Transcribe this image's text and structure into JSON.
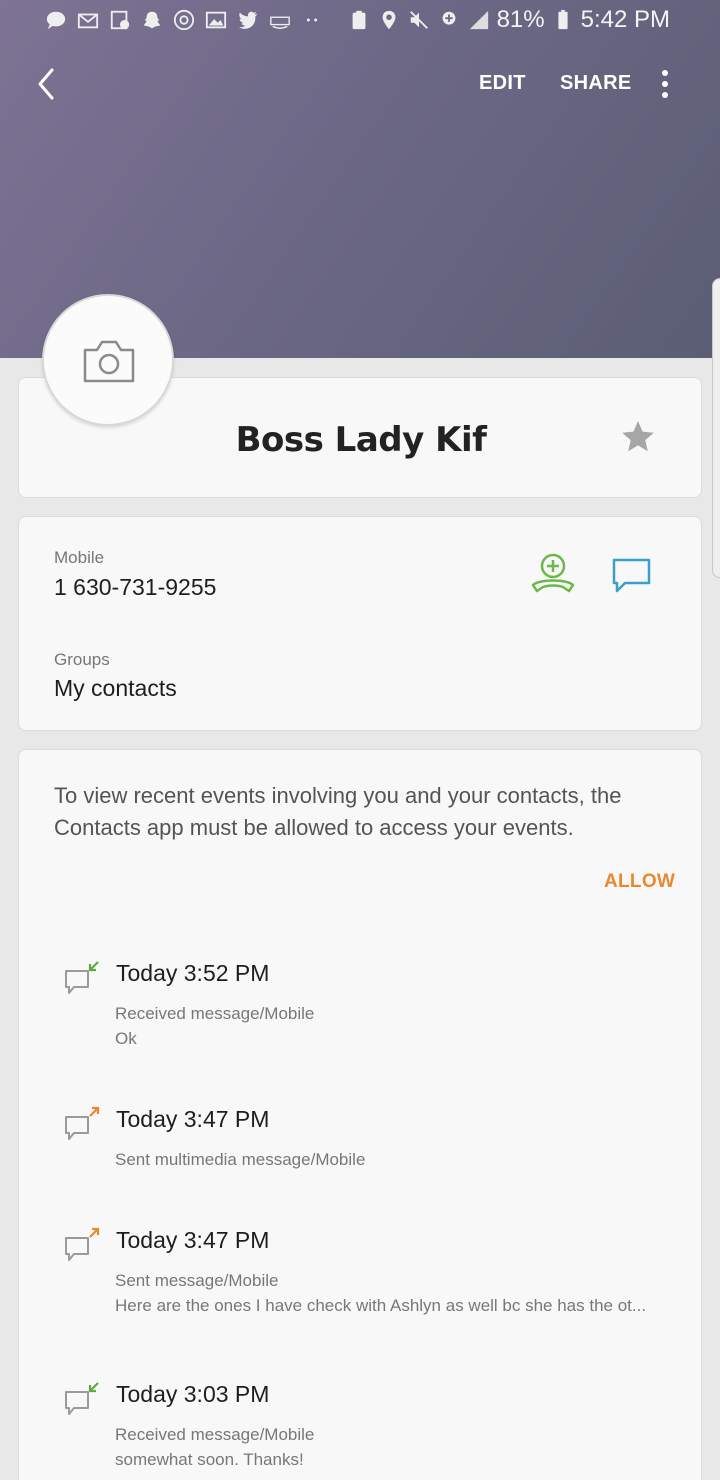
{
  "status_bar": {
    "battery": "81%",
    "time": "5:42 PM",
    "network": "LTE"
  },
  "toolbar": {
    "edit_label": "EDIT",
    "share_label": "SHARE"
  },
  "contact": {
    "name": "Boss Lady Kif",
    "mobile_label": "Mobile",
    "mobile_number": "1 630-731-9255",
    "groups_label": "Groups",
    "groups_value": "My contacts"
  },
  "events": {
    "permission_text": "To view recent events involving you and your contacts, the Contacts app must be allowed to access your events.",
    "allow_label": "ALLOW",
    "items": [
      {
        "title": "Today 3:52 PM",
        "type": "Received message/Mobile",
        "body": "Ok",
        "direction": "received"
      },
      {
        "title": "Today 3:47 PM",
        "type": "Sent multimedia message/Mobile",
        "body": "",
        "direction": "sent"
      },
      {
        "title": "Today 3:47 PM",
        "type": "Sent message/Mobile",
        "body": "Here are the ones I have check with Ashlyn as well bc she has the ot...",
        "direction": "sent"
      },
      {
        "title": "Today 3:03 PM",
        "type": "Received message/Mobile",
        "body": "somewhat soon. Thanks!",
        "direction": "received"
      }
    ]
  },
  "colors": {
    "accent_orange": "#e8892f",
    "call_green": "#6cb84a",
    "message_blue": "#3aa0c8",
    "received_arrow": "#5aac3c",
    "sent_arrow": "#e8892f"
  },
  "icons": [
    "back-arrow-icon",
    "more-options-icon",
    "camera-icon",
    "star-icon",
    "call-icon",
    "message-icon",
    "message-received-icon",
    "message-sent-icon"
  ]
}
